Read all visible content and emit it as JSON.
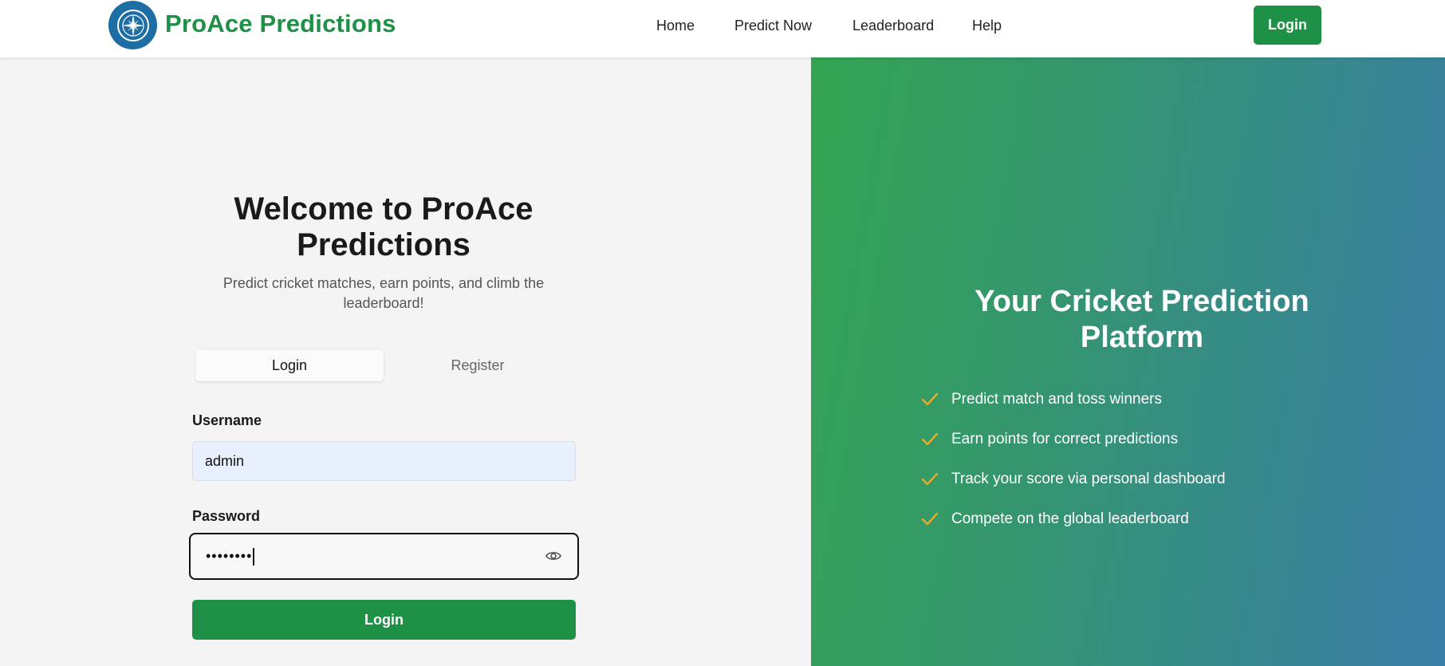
{
  "header": {
    "brand": "ProAce Predictions",
    "logo_icon": "compass-logo-icon",
    "nav": [
      "Home",
      "Predict Now",
      "Leaderboard",
      "Help"
    ],
    "login_label": "Login"
  },
  "auth": {
    "title": "Welcome to ProAce Predictions",
    "subtitle": "Predict cricket matches, earn points, and climb the leaderboard!",
    "tabs": {
      "login": "Login",
      "register": "Register",
      "active": "Login"
    },
    "username_label": "Username",
    "username_value": "admin",
    "password_label": "Password",
    "password_value": "••••••••",
    "submit_label": "Login"
  },
  "promo": {
    "title": "Your Cricket Prediction Platform",
    "features": [
      "Predict match and toss winners",
      "Earn points for correct predictions",
      "Track your score via personal dashboard",
      "Compete on the global leaderboard"
    ]
  },
  "colors": {
    "brand_green": "#1f9147",
    "logo_blue": "#1c6ea4",
    "check_orange": "#f2a622",
    "gradient_start": "#33a552",
    "gradient_end": "#3a7da8"
  }
}
